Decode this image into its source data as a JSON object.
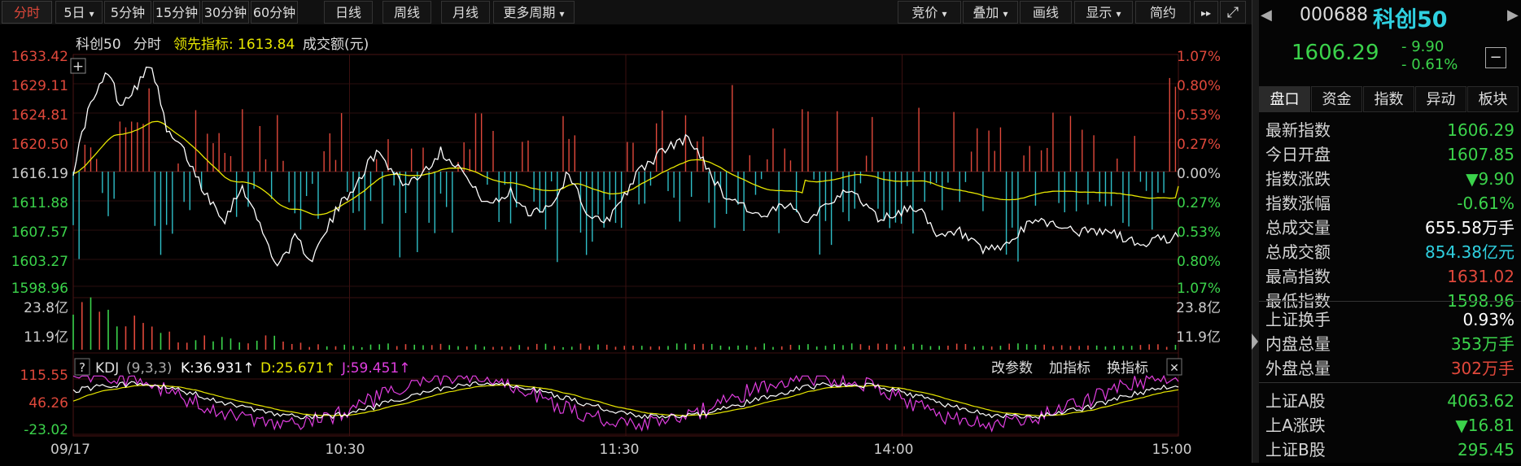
{
  "toolbar": {
    "periods": [
      "分时",
      "5日",
      "5分钟",
      "15分钟",
      "30分钟",
      "60分钟",
      "日线",
      "周线",
      "月线",
      "更多周期"
    ],
    "right_buttons": [
      "竞价",
      "叠加",
      "画线",
      "显示",
      "简约"
    ],
    "dropdown_glyph": "▾",
    "more_glyph": "▸▸",
    "fullscreen_glyph": "⤢"
  },
  "legend": {
    "name": "科创50",
    "mode": "分时",
    "lead_label": "领先指标:",
    "lead_value": "1613.84",
    "volume_label": "成交额(元)",
    "plus": "+"
  },
  "price_axis": {
    "left": [
      "1633.42",
      "1629.11",
      "1624.81",
      "1620.50",
      "1616.19",
      "1611.88",
      "1607.57",
      "1603.27",
      "1598.96"
    ],
    "right": [
      "1.07%",
      "0.80%",
      "0.53%",
      "0.27%",
      "0.00%",
      "0.27%",
      "0.53%",
      "0.80%",
      "1.07%"
    ]
  },
  "volume_axis": {
    "left": [
      "23.8亿",
      "11.9亿"
    ],
    "right": [
      "23.8亿",
      "11.9亿"
    ]
  },
  "kdj": {
    "help": "?",
    "name": "KDJ",
    "params": "(9,3,3)",
    "k": "K:36.931↑",
    "d": "D:25.671↑",
    "j": "J:59.451↑",
    "actions": [
      "改参数",
      "加指标",
      "换指标"
    ],
    "close": "✕",
    "axis": [
      "115.55",
      "46.26",
      "-23.02"
    ]
  },
  "time_axis": [
    "09/17",
    "10:30",
    "11:30",
    "14:00",
    "15:00"
  ],
  "chart_data": {
    "type": "line",
    "title": "科创50 分时",
    "series": [
      {
        "name": "科创50",
        "color": "#ffffff"
      },
      {
        "name": "领先指标",
        "color": "#e6e600"
      }
    ],
    "ylim": [
      1598.96,
      1633.42
    ],
    "prev_close": 1616.19,
    "x_ticks": [
      "09/17",
      "10:30",
      "11:30",
      "14:00",
      "15:00"
    ],
    "last_price": 1606.29,
    "last_lead": 1613.84,
    "colors": {
      "up": "#e0483b",
      "down": "#2fbfc8",
      "price": "#ffffff",
      "lead": "#e6e600",
      "k": "#ffffff",
      "d": "#e6e600",
      "j": "#e03ee0"
    }
  },
  "quote": {
    "code": "000688",
    "name": "科创50",
    "price": "1606.29",
    "change": "- 9.90",
    "change_pct": "- 0.61%",
    "prev_arrow": "◀",
    "next_arrow": "▶",
    "collapse": "−"
  },
  "tabs": [
    "盘口",
    "资金",
    "指数",
    "异动",
    "板块"
  ],
  "stats": [
    {
      "k": "最新指数",
      "v": "1606.29",
      "c": "#3bd34b"
    },
    {
      "k": "今日开盘",
      "v": "1607.85",
      "c": "#3bd34b"
    },
    {
      "k": "指数涨跌",
      "v": "▼9.90",
      "c": "#3bd34b"
    },
    {
      "k": "指数涨幅",
      "v": "-0.61%",
      "c": "#3bd34b"
    },
    {
      "k": "总成交量",
      "v": "655.58",
      "u": "万手",
      "c": "#ffffff",
      "uc": "#ffffff"
    },
    {
      "k": "总成交额",
      "v": "854.38",
      "u": "亿元",
      "c": "#2fd0e0",
      "uc": "#2fd0e0"
    },
    {
      "k": "最高指数",
      "v": "1631.02",
      "c": "#e0483b"
    },
    {
      "k": "最低指数",
      "v": "1598.96",
      "c": "#3bd34b"
    }
  ],
  "stats2": [
    {
      "k": "上证换手",
      "v": "0.93%",
      "c": "#ffffff"
    },
    {
      "k": "内盘总量",
      "v": "353",
      "u": "万手",
      "c": "#3bd34b",
      "uc": "#3bd34b"
    },
    {
      "k": "外盘总量",
      "v": "302",
      "u": "万手",
      "c": "#e0483b",
      "uc": "#e0483b"
    }
  ],
  "stats3": [
    {
      "k": "上证A股",
      "v": "4063.62",
      "c": "#3bd34b"
    },
    {
      "k": "上A涨跌",
      "v": "▼16.81",
      "c": "#3bd34b"
    },
    {
      "k": "上证B股",
      "v": "295.45",
      "c": "#3bd34b"
    }
  ]
}
